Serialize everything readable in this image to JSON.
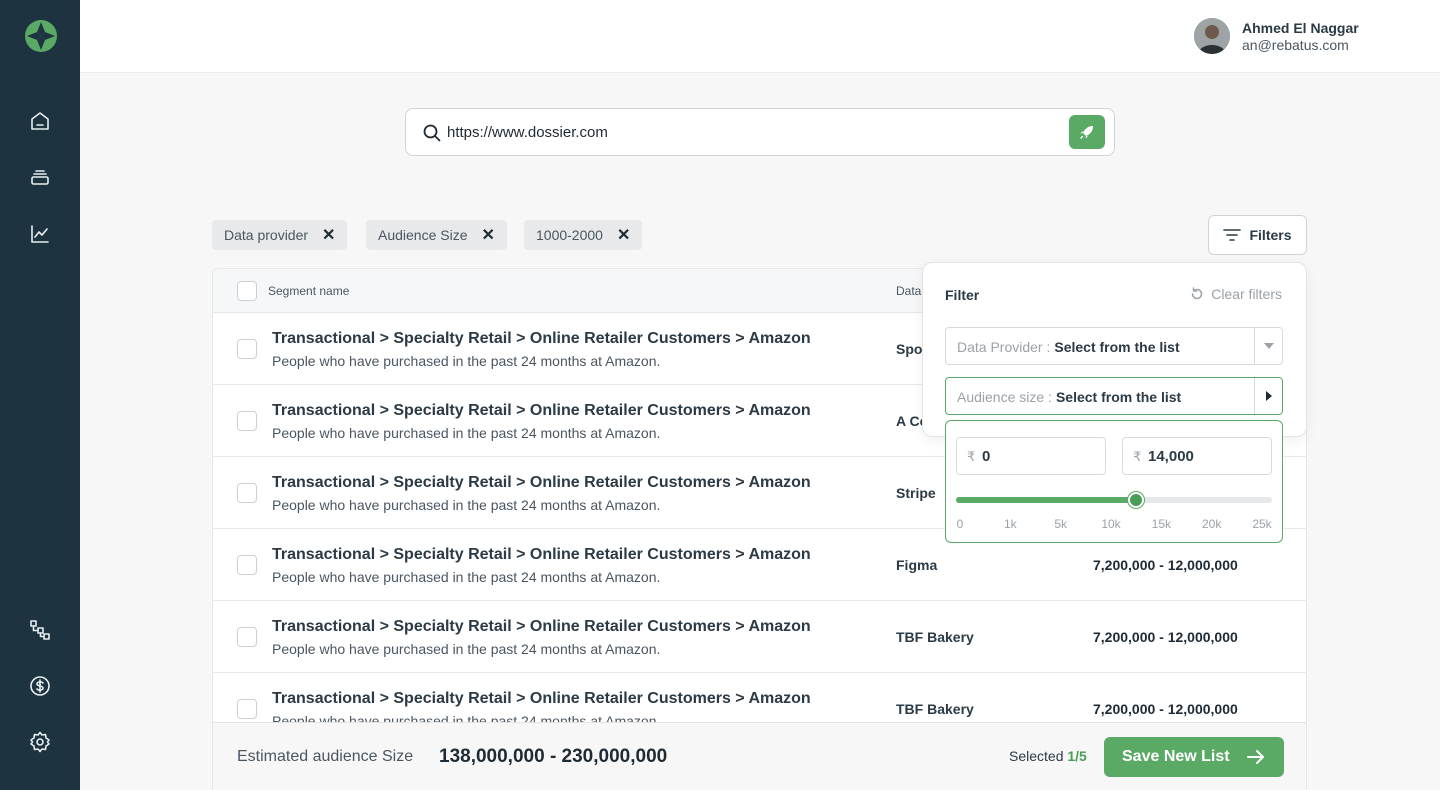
{
  "user": {
    "name": "Ahmed El Naggar",
    "email": "an@rebatus.com"
  },
  "search": {
    "value": "https://www.dossier.com",
    "placeholder": ""
  },
  "chips": [
    "Data provider",
    "Audience Size",
    "1000-2000"
  ],
  "filters_button": "Filters",
  "table": {
    "headers": {
      "segment": "Segment name",
      "provider": "Data"
    },
    "rows": [
      {
        "title": "Transactional > Specialty Retail > Online Retailer Customers > Amazon",
        "desc": "People who have purchased in the past 24 months at Amazon.",
        "provider": "Spo",
        "size": ""
      },
      {
        "title": "Transactional > Specialty Retail > Online Retailer Customers > Amazon",
        "desc": "People who have purchased in the past 24 months at Amazon.",
        "provider": "A Co",
        "size": ""
      },
      {
        "title": "Transactional > Specialty Retail > Online Retailer Customers > Amazon",
        "desc": "People who have purchased in the past 24 months at Amazon.",
        "provider": "Stripe",
        "size": ""
      },
      {
        "title": "Transactional > Specialty Retail > Online Retailer Customers > Amazon",
        "desc": "People who have purchased in the past 24 months at Amazon.",
        "provider": "Figma",
        "size": "7,200,000 - 12,000,000"
      },
      {
        "title": "Transactional > Specialty Retail > Online Retailer Customers > Amazon",
        "desc": "People who have purchased in the past 24 months at Amazon.",
        "provider": "TBF Bakery",
        "size": "7,200,000 - 12,000,000"
      },
      {
        "title": "Transactional > Specialty Retail > Online Retailer Customers > Amazon",
        "desc": "People who have purchased in the past 24 months at Amazon.",
        "provider": "TBF Bakery",
        "size": "7,200,000 - 12,000,000"
      }
    ]
  },
  "filter_panel": {
    "title": "Filter",
    "clear": "Clear filters",
    "data_provider": {
      "label": "Data Provider :",
      "value": "Select from the list"
    },
    "audience_size": {
      "label": "Audience size :",
      "value": "Select from the list"
    },
    "range": {
      "currency": "₹",
      "min": "0",
      "max": "14,000",
      "value_fraction": 0.57,
      "ticks": [
        "0",
        "1k",
        "5k",
        "10k",
        "15k",
        "20k",
        "25k"
      ]
    }
  },
  "footer": {
    "estimated_label": "Estimated audience Size",
    "estimated_value": "138,000,000 - 230,000,000",
    "selected_label": "Selected",
    "selected_value": "1/5",
    "save_button": "Save New List"
  },
  "colors": {
    "sidebar": "#1d3440",
    "accent": "#5aaa66"
  }
}
